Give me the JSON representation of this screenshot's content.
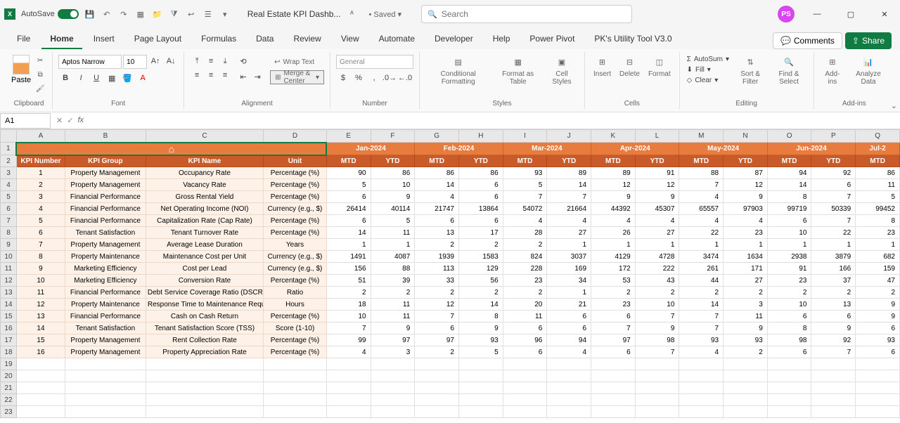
{
  "title": {
    "autosave": "AutoSave",
    "filename": "Real Estate KPI Dashb...",
    "saved": "Saved",
    "search_placeholder": "Search",
    "avatar": "PS"
  },
  "tabs": [
    "File",
    "Home",
    "Insert",
    "Page Layout",
    "Formulas",
    "Data",
    "Review",
    "View",
    "Automate",
    "Developer",
    "Help",
    "Power Pivot",
    "PK's Utility Tool V3.0"
  ],
  "ribbon_right": {
    "comments": "Comments",
    "share": "Share"
  },
  "ribbon": {
    "clipboard": {
      "paste": "Paste",
      "label": "Clipboard"
    },
    "font": {
      "name": "Aptos Narrow",
      "size": "10",
      "label": "Font"
    },
    "alignment": {
      "wrap": "Wrap Text",
      "merge": "Merge & Center",
      "label": "Alignment"
    },
    "number": {
      "format": "General",
      "label": "Number"
    },
    "styles": {
      "cond": "Conditional Formatting",
      "fat": "Format as Table",
      "cell": "Cell Styles",
      "label": "Styles"
    },
    "cells": {
      "insert": "Insert",
      "delete": "Delete",
      "format": "Format",
      "label": "Cells"
    },
    "editing": {
      "sum": "AutoSum",
      "fill": "Fill",
      "clear": "Clear",
      "sort": "Sort & Filter",
      "find": "Find & Select",
      "label": "Editing"
    },
    "addins": {
      "addins": "Add-ins",
      "analyze": "Analyze Data",
      "label": "Add-ins"
    }
  },
  "namebox": "A1",
  "columns": [
    "A",
    "B",
    "C",
    "D",
    "E",
    "F",
    "G",
    "H",
    "I",
    "J",
    "K",
    "L",
    "M",
    "N",
    "O",
    "P",
    "Q"
  ],
  "months": [
    "Jan-2024",
    "Feb-2024",
    "Mar-2024",
    "Apr-2024",
    "May-2024",
    "Jun-2024",
    "Jul-2"
  ],
  "headers": {
    "kpinum": "KPI Number",
    "group": "KPI Group",
    "name": "KPI Name",
    "unit": "Unit",
    "mtd": "MTD",
    "ytd": "YTD"
  },
  "rows": [
    {
      "n": "1",
      "g": "Property Management",
      "k": "Occupancy Rate",
      "u": "Percentage (%)",
      "v": [
        "90",
        "86",
        "86",
        "86",
        "93",
        "89",
        "89",
        "91",
        "88",
        "87",
        "94",
        "92",
        "86"
      ]
    },
    {
      "n": "2",
      "g": "Property Management",
      "k": "Vacancy Rate",
      "u": "Percentage (%)",
      "v": [
        "5",
        "10",
        "14",
        "6",
        "5",
        "14",
        "12",
        "12",
        "7",
        "12",
        "14",
        "6",
        "11"
      ]
    },
    {
      "n": "3",
      "g": "Financial Performance",
      "k": "Gross Rental Yield",
      "u": "Percentage (%)",
      "v": [
        "6",
        "9",
        "4",
        "6",
        "7",
        "7",
        "9",
        "9",
        "4",
        "9",
        "8",
        "7",
        "5"
      ]
    },
    {
      "n": "4",
      "g": "Financial Performance",
      "k": "Net Operating Income (NOI)",
      "u": "Currency (e.g., $)",
      "v": [
        "26414",
        "40114",
        "21747",
        "13864",
        "54072",
        "21664",
        "44392",
        "45307",
        "65557",
        "97903",
        "99719",
        "50339",
        "99452"
      ]
    },
    {
      "n": "5",
      "g": "Financial Performance",
      "k": "Capitalization Rate (Cap Rate)",
      "u": "Percentage (%)",
      "v": [
        "6",
        "5",
        "6",
        "6",
        "4",
        "4",
        "4",
        "4",
        "4",
        "4",
        "6",
        "7",
        "8"
      ]
    },
    {
      "n": "6",
      "g": "Tenant Satisfaction",
      "k": "Tenant Turnover Rate",
      "u": "Percentage (%)",
      "v": [
        "14",
        "11",
        "13",
        "17",
        "28",
        "27",
        "26",
        "27",
        "22",
        "23",
        "10",
        "22",
        "23"
      ]
    },
    {
      "n": "7",
      "g": "Property Management",
      "k": "Average Lease Duration",
      "u": "Years",
      "v": [
        "1",
        "1",
        "2",
        "2",
        "2",
        "1",
        "1",
        "1",
        "1",
        "1",
        "1",
        "1",
        "1"
      ]
    },
    {
      "n": "8",
      "g": "Property Maintenance",
      "k": "Maintenance Cost per Unit",
      "u": "Currency (e.g., $)",
      "v": [
        "1491",
        "4087",
        "1939",
        "1583",
        "824",
        "3037",
        "4129",
        "4728",
        "3474",
        "1634",
        "2938",
        "3879",
        "682"
      ]
    },
    {
      "n": "9",
      "g": "Marketing Efficiency",
      "k": "Cost per Lead",
      "u": "Currency (e.g., $)",
      "v": [
        "156",
        "88",
        "113",
        "129",
        "228",
        "169",
        "172",
        "222",
        "261",
        "171",
        "91",
        "166",
        "159"
      ]
    },
    {
      "n": "10",
      "g": "Marketing Efficiency",
      "k": "Conversion Rate",
      "u": "Percentage (%)",
      "v": [
        "51",
        "39",
        "33",
        "56",
        "23",
        "34",
        "53",
        "43",
        "44",
        "27",
        "23",
        "37",
        "47"
      ]
    },
    {
      "n": "11",
      "g": "Financial Performance",
      "k": "Debt Service Coverage Ratio (DSCR)",
      "u": "Ratio",
      "v": [
        "2",
        "2",
        "2",
        "2",
        "2",
        "1",
        "2",
        "2",
        "2",
        "2",
        "2",
        "2",
        "2"
      ]
    },
    {
      "n": "12",
      "g": "Property Maintenance",
      "k": "Response Time to Maintenance Requests",
      "u": "Hours",
      "v": [
        "18",
        "11",
        "12",
        "14",
        "20",
        "21",
        "23",
        "10",
        "14",
        "3",
        "10",
        "13",
        "9"
      ]
    },
    {
      "n": "13",
      "g": "Financial Performance",
      "k": "Cash on Cash Return",
      "u": "Percentage (%)",
      "v": [
        "10",
        "11",
        "7",
        "8",
        "11",
        "6",
        "6",
        "7",
        "7",
        "11",
        "6",
        "6",
        "9"
      ]
    },
    {
      "n": "14",
      "g": "Tenant Satisfaction",
      "k": "Tenant Satisfaction Score (TSS)",
      "u": "Score (1-10)",
      "v": [
        "7",
        "9",
        "6",
        "9",
        "6",
        "6",
        "7",
        "9",
        "7",
        "9",
        "8",
        "9",
        "6"
      ]
    },
    {
      "n": "15",
      "g": "Property Management",
      "k": "Rent Collection Rate",
      "u": "Percentage (%)",
      "v": [
        "99",
        "97",
        "97",
        "93",
        "96",
        "94",
        "97",
        "98",
        "93",
        "93",
        "98",
        "92",
        "93"
      ]
    },
    {
      "n": "16",
      "g": "Property Management",
      "k": "Property Appreciation Rate",
      "u": "Percentage (%)",
      "v": [
        "4",
        "3",
        "2",
        "5",
        "6",
        "4",
        "6",
        "7",
        "4",
        "2",
        "6",
        "7",
        "6"
      ]
    }
  ],
  "empty_rows": [
    19,
    20,
    21,
    22,
    23
  ]
}
